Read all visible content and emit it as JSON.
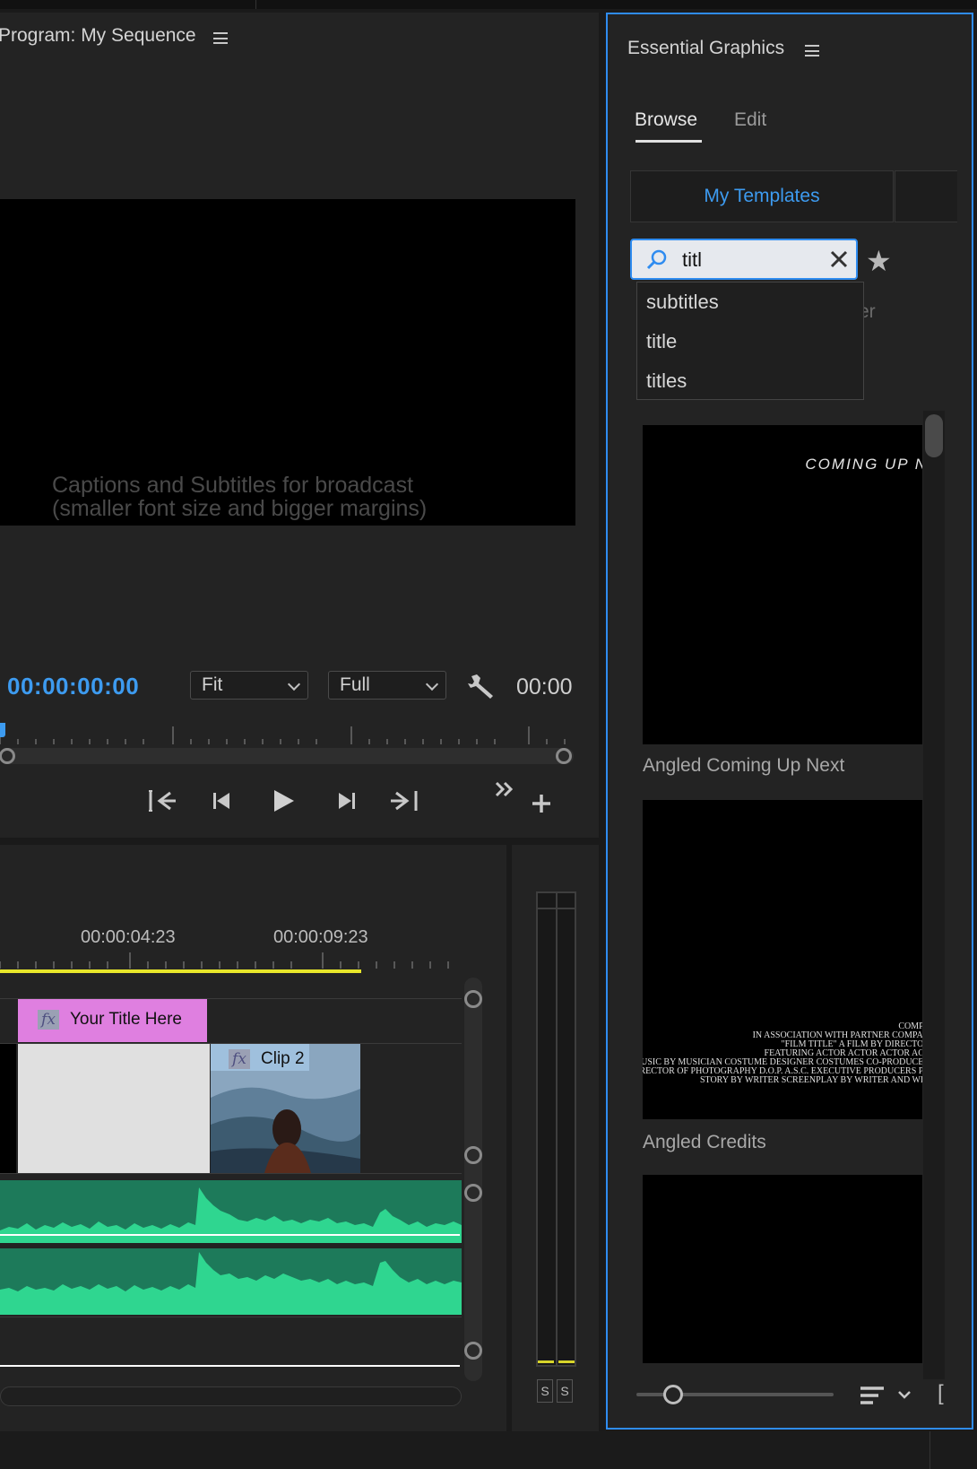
{
  "program": {
    "title": "Program: My Sequence",
    "caption_line1": "Captions and Subtitles for broadcast",
    "caption_line2": "(smaller font size and bigger margins)",
    "timecode": "00:00:00:00",
    "zoom": "Fit",
    "resolution": "Full",
    "timecode_right": "00:00"
  },
  "timeline": {
    "times": [
      "00:00:04:23",
      "00:00:09:23"
    ],
    "clips": {
      "title_clip": "Your Title Here",
      "clip2": "Clip 2",
      "fx": "fx"
    }
  },
  "meter": {
    "solo_left": "S",
    "solo_right": "S"
  },
  "essential_graphics": {
    "title": "Essential Graphics",
    "tabs": [
      "Browse",
      "Edit"
    ],
    "active_tab": "Browse",
    "templates_tab": "My Templates",
    "search_value": "titl",
    "suggestions": [
      "subtitles",
      "title",
      "titles"
    ],
    "peek_text": "er",
    "templates": [
      {
        "name": "Angled Coming Up Next",
        "preview_text": "COMING UP N"
      },
      {
        "name": "Angled Credits",
        "preview_lines": [
          "COMPA",
          "IN ASSOCIATION WITH PARTNER COMPAN",
          "\"FILM TITLE\" A FILM BY DIRECTOR",
          "FEATURING ACTOR ACTOR ACTOR ACT",
          "MUSIC BY MUSICIAN COSTUME DESIGNER COSTUMES CO-PRODUCER",
          "DIRECTOR OF PHOTOGRAPHY D.O.P. A.S.C. EXECUTIVE PRODUCERS PR",
          "STORY BY WRITER SCREENPLAY BY WRITER AND WRI"
        ]
      },
      {
        "name": ""
      }
    ],
    "bracket": "["
  },
  "colors": {
    "accent": "#3d9bf0",
    "panel_focus_border": "#2f8cf0",
    "title_clip": "#df7fe0",
    "audio_track": "#1d7a5a",
    "waveform": "#2fd690",
    "work_area": "#e8e62a"
  },
  "icons": [
    "menu-icon",
    "wrench-icon",
    "go-to-in-icon",
    "step-back-icon",
    "play-icon",
    "step-forward-icon",
    "go-to-out-icon",
    "more-icon",
    "add-icon",
    "search-icon",
    "clear-icon",
    "star-icon",
    "sort-icon",
    "chevron-down-icon"
  ]
}
